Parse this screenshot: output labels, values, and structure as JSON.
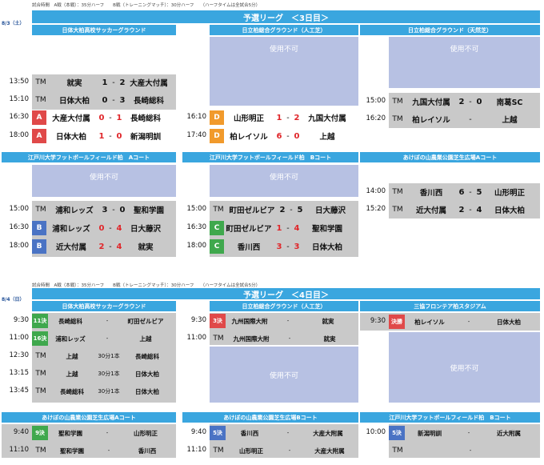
{
  "day1": {
    "note_left": "試合時間　A戦（本戦）：35分ハーフ　　B戦（トレーニングマッチ）：30分ハーフ　　（ハーフタイムは全試合5分）",
    "date": "8/3（土）",
    "league": "予選リーグ　＜3日目＞",
    "venues": [
      "日体大柏高校サッカーグラウンド",
      "日立柏総合グラウンド（人工芝）",
      "日立柏総合グラウンド（天然芝）"
    ],
    "unavailable": "使用不可",
    "col1": [
      {
        "time": "13:50",
        "badge": "TM",
        "team1": "就実",
        "s1": "1",
        "dash": "-",
        "s2": "2",
        "team2": "大産大付属"
      },
      {
        "time": "15:10",
        "badge": "TM",
        "team1": "日体大柏",
        "s1": "0",
        "dash": "-",
        "s2": "3",
        "team2": "長崎総科"
      },
      {
        "time": "16:30",
        "badge": "A",
        "team1": "大産大付属",
        "s1": "0",
        "dash": "-",
        "s2": "1",
        "team2": "長崎総科"
      },
      {
        "time": "18:00",
        "badge": "A",
        "team1": "日体大柏",
        "s1": "1",
        "dash": "-",
        "s2": "0",
        "team2": "新潟明訓"
      }
    ],
    "col2": [
      {
        "time": "16:10",
        "badge": "D",
        "team1": "山形明正",
        "s1": "1",
        "dash": "-",
        "s2": "2",
        "team2": "九国大付属"
      },
      {
        "time": "17:40",
        "badge": "D",
        "team1": "柏レイソル",
        "s1": "6",
        "dash": "-",
        "s2": "0",
        "team2": "上越"
      }
    ],
    "col3": [
      {
        "time": "15:00",
        "badge": "TM",
        "team1": "九国大付属",
        "s1": "2",
        "dash": "-",
        "s2": "0",
        "team2": "南葛SC"
      },
      {
        "time": "16:20",
        "badge": "TM",
        "team1": "柏レイソル",
        "s1": "",
        "dash": "-",
        "s2": "",
        "team2": "上越"
      }
    ],
    "venues2": [
      "江戸川大学フットボールフィールド柏　Aコート",
      "江戸川大学フットボールフィールド柏　Bコート",
      "あけぼの山農業公園芝生広場Aコート"
    ],
    "col4": [
      {
        "time": "15:00",
        "badge": "TM",
        "team1": "浦和レッズ",
        "s1": "3",
        "dash": "-",
        "s2": "0",
        "team2": "聖和学園"
      },
      {
        "time": "16:30",
        "badge": "B",
        "team1": "浦和レッズ",
        "s1": "0",
        "dash": "-",
        "s2": "4",
        "team2": "日大藤沢"
      },
      {
        "time": "18:00",
        "badge": "B",
        "team1": "近大付属",
        "s1": "2",
        "dash": "-",
        "s2": "4",
        "team2": "就実"
      }
    ],
    "col5": [
      {
        "time": "15:00",
        "badge": "TM",
        "team1": "町田ゼルビア",
        "s1": "2",
        "dash": "-",
        "s2": "5",
        "team2": "日大藤沢"
      },
      {
        "time": "16:30",
        "badge": "C",
        "team1": "町田ゼルビア",
        "s1": "1",
        "dash": "-",
        "s2": "4",
        "team2": "聖和学園"
      },
      {
        "time": "18:00",
        "badge": "C",
        "team1": "香川西",
        "s1": "3",
        "dash": "-",
        "s2": "3",
        "team2": "日体大柏"
      }
    ],
    "col6": [
      {
        "time": "14:00",
        "badge": "TM",
        "team1": "香川西",
        "s1": "6",
        "dash": "-",
        "s2": "5",
        "team2": "山形明正"
      },
      {
        "time": "15:20",
        "badge": "TM",
        "team1": "近大付属",
        "s1": "2",
        "dash": "-",
        "s2": "4",
        "team2": "日体大柏"
      }
    ]
  },
  "day2": {
    "note_left": "試合時間　A戦（本戦）：35分ハーフ　　B戦（トレーニングマッチ）：30分ハーフ　　（ハーフタイムは全試合5分）",
    "date": "8/4（日）",
    "league": "予選リーグ　＜4日目＞",
    "venues": [
      "日体大柏高校サッカーグラウンド",
      "日立柏総合グラウンド（人工芝）",
      "三協フロンテア柏スタジアム"
    ],
    "unavailable": "使用不可",
    "col1": [
      {
        "time": "9:30",
        "badge": "11決",
        "team1": "長崎総科",
        "mid": "-",
        "team2": "町田ゼルビア"
      },
      {
        "time": "11:00",
        "badge": "16決",
        "team1": "浦和レッズ",
        "mid": "-",
        "team2": "上越"
      },
      {
        "time": "12:30",
        "badge": "TM",
        "team1": "上越",
        "mid": "30分1本",
        "team2": "長崎総科"
      },
      {
        "time": "13:15",
        "badge": "TM",
        "team1": "上越",
        "mid": "30分1本",
        "team2": "日体大柏"
      },
      {
        "time": "13:45",
        "badge": "TM",
        "team1": "長崎総科",
        "mid": "30分1本",
        "team2": "日体大柏"
      }
    ],
    "col2": [
      {
        "time": "9:30",
        "badge": "3決",
        "team1": "九州国際大附",
        "mid": "-",
        "team2": "就実"
      },
      {
        "time": "11:00",
        "badge": "TM",
        "team1": "九州国際大附",
        "mid": "-",
        "team2": "就実"
      }
    ],
    "col3": [
      {
        "time": "9:30",
        "badge": "決勝",
        "team1": "柏レイソル",
        "mid": "-",
        "team2": "日体大柏"
      }
    ],
    "venues2": [
      "あけぼの山農業公園芝生広場Aコート",
      "あけぼの山農業公園芝生広場Bコート",
      "江戸川大学フットボールフィールド柏　Bコート"
    ],
    "col4": [
      {
        "time": "9:40",
        "badge": "9決",
        "team1": "聖和学園",
        "mid": "-",
        "team2": "山形明正"
      },
      {
        "time": "11:10",
        "badge": "TM",
        "team1": "聖和学園",
        "mid": "-",
        "team2": "香川西"
      }
    ],
    "col5": [
      {
        "time": "9:40",
        "badge": "5決",
        "team1": "香川西",
        "mid": "-",
        "team2": "大産大附属"
      },
      {
        "time": "11:10",
        "badge": "TM",
        "team1": "山形明正",
        "mid": "-",
        "team2": "大産大附属"
      }
    ],
    "col6": [
      {
        "time": "10:00",
        "badge": "5決",
        "team1": "新潟明訓",
        "mid": "-",
        "team2": "近大附属"
      },
      {
        "time": "",
        "badge": "TM",
        "team1": "",
        "mid": "-",
        "team2": ""
      }
    ]
  }
}
